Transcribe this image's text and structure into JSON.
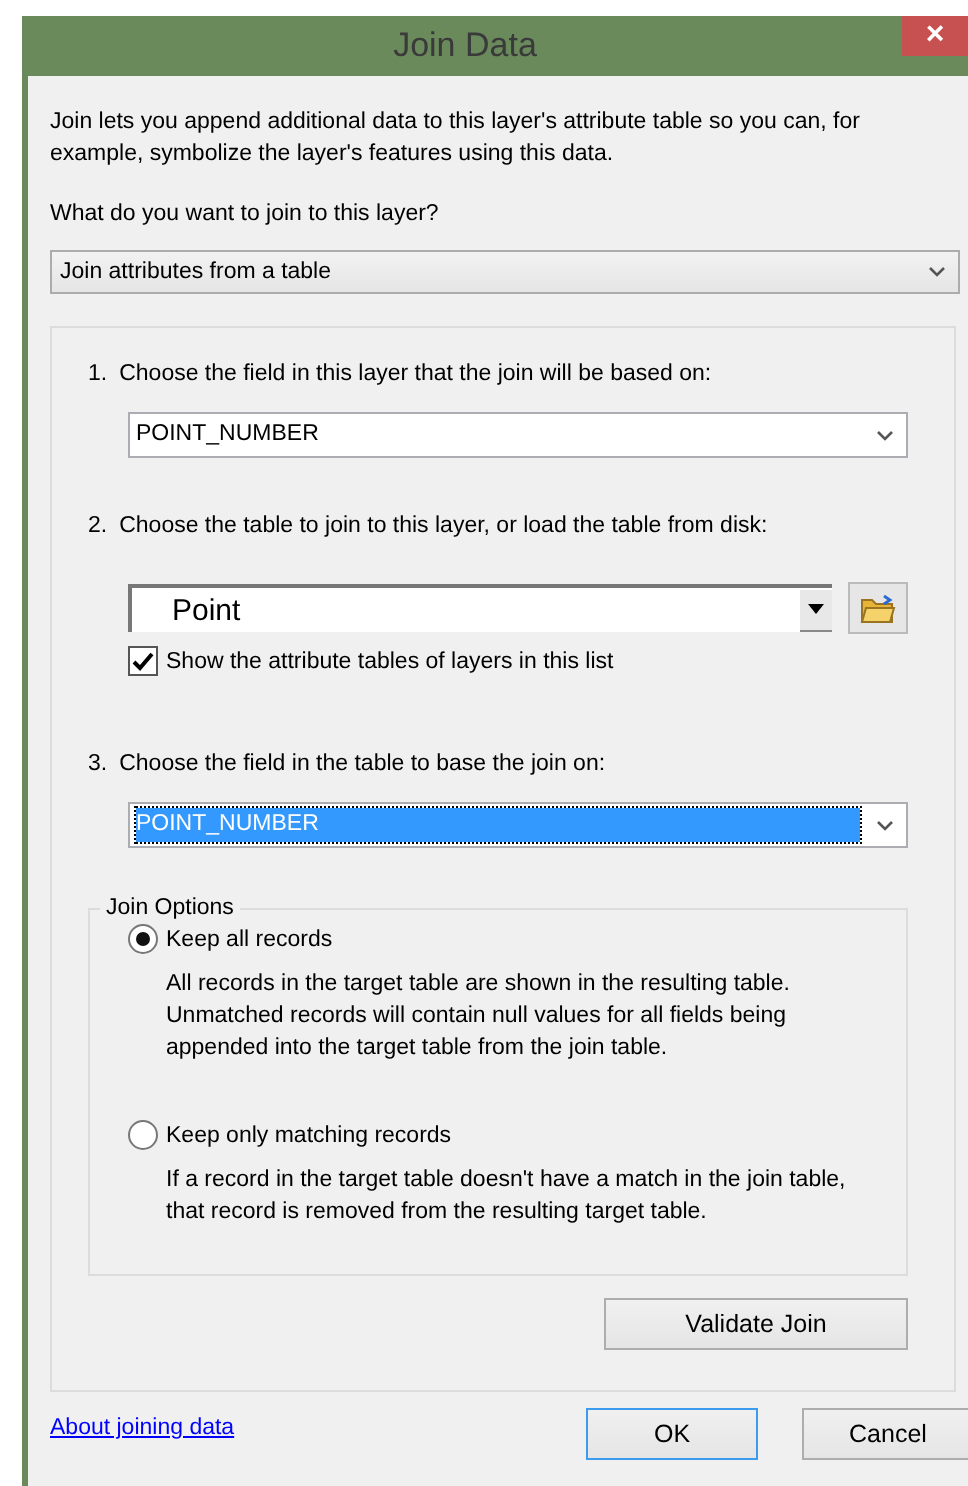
{
  "window": {
    "title": "Join Data",
    "close": "×"
  },
  "intro": "Join lets you append additional data to this layer's attribute table so you can, for example, symbolize the layer's features using this data.",
  "question": "What do you want to join to this layer?",
  "join_type": {
    "value": "Join attributes from a table"
  },
  "steps": [
    {
      "number": "1.",
      "label": "Choose the field in this layer that the join will be based on:",
      "field": {
        "kind": "dropdown",
        "value": "POINT_NUMBER",
        "selected": false
      }
    },
    {
      "number": "2.",
      "label": "Choose the table to join to this layer, or load the table from disk:",
      "field": {
        "kind": "classic",
        "value": "Point",
        "selected": false
      },
      "checkbox": {
        "label": "Show the attribute tables of layers in this list",
        "checked": true
      }
    },
    {
      "number": "3.",
      "label": "Choose the field in the table to base the join on:",
      "field": {
        "kind": "dropdown",
        "value": "POINT_NUMBER",
        "selected": true
      }
    }
  ],
  "join_options": {
    "title": "Join Options",
    "options": [
      {
        "label": "Keep all records",
        "selected": true,
        "description": "All records in the target table are shown in the resulting table. Unmatched records will contain null values for all fields being appended into the target table from the join table."
      },
      {
        "label": "Keep only matching records",
        "selected": false,
        "description": "If a record in the target table doesn't have a match in the join table, that record is removed from the resulting target table."
      }
    ]
  },
  "validate_button": "Validate Join",
  "help_link": "About joining data",
  "buttons": [
    {
      "label": "OK",
      "default": true
    },
    {
      "label": "Cancel",
      "default": false
    }
  ]
}
